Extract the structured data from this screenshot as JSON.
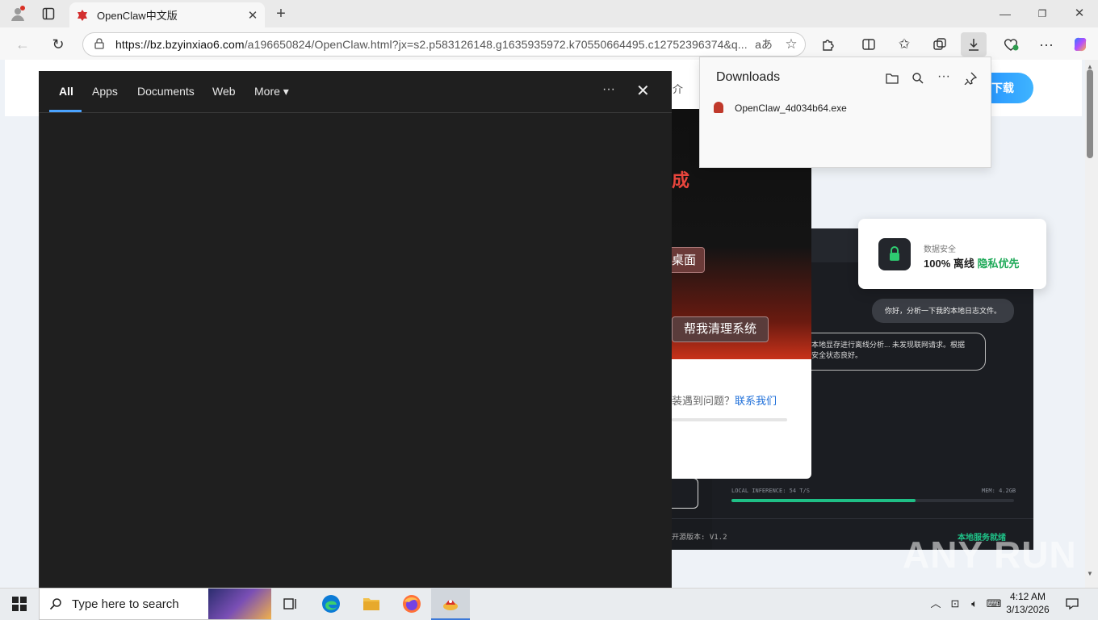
{
  "browser": {
    "tab_title": "OpenClaw中文版",
    "tab_close": "✕",
    "new_tab": "+",
    "url_domain": "https://bz.bzyinxiao6.com",
    "url_rest": "/a196650824/OpenClaw.html?jx=s2.p583126148.g1635935972.k70550664495.c12752396374&q...",
    "translate_icon": "aあ"
  },
  "downloads": {
    "title": "Downloads",
    "file_name": "OpenClaw_4d034b64.exe"
  },
  "page": {
    "download_button": "下载",
    "security_label": "数据安全",
    "security_value_prefix": "100% 离线",
    "security_value_highlight": "隐私优先",
    "bubble_user": "你好，分析一下我的本地日志文件。",
    "bubble_reply": "本地显存进行离线分析... 未发现联网请求。根据\n安全状态良好。",
    "infer_label": "LOCAL INFERENCE: 54 T/S",
    "mem_label": "MEM: 4.2GB",
    "progress": 0.65,
    "version_label": "开源版本: V1.2",
    "service_label": "本地服务就绪",
    "side_text": "介"
  },
  "installer": {
    "minimize": "—",
    "red_text": "成",
    "button1": "桌面",
    "button2": "帮我清理系统",
    "question": "装遇到问题？",
    "contact_link": "联系我们"
  },
  "search_overlay": {
    "tabs": [
      "All",
      "Apps",
      "Documents",
      "Web",
      "More"
    ],
    "more_arrow": "▾",
    "dots": "···",
    "close": "✕"
  },
  "taskbar": {
    "search_placeholder": "Type here to search",
    "time": "4:12 AM",
    "date": "3/13/2026"
  },
  "watermark": "ANY RUN",
  "colors": {
    "accent": "#4aa3ff",
    "download_blue": "#1f8cff",
    "security_green": "#1faa59",
    "installer_red": "#e8453c"
  }
}
